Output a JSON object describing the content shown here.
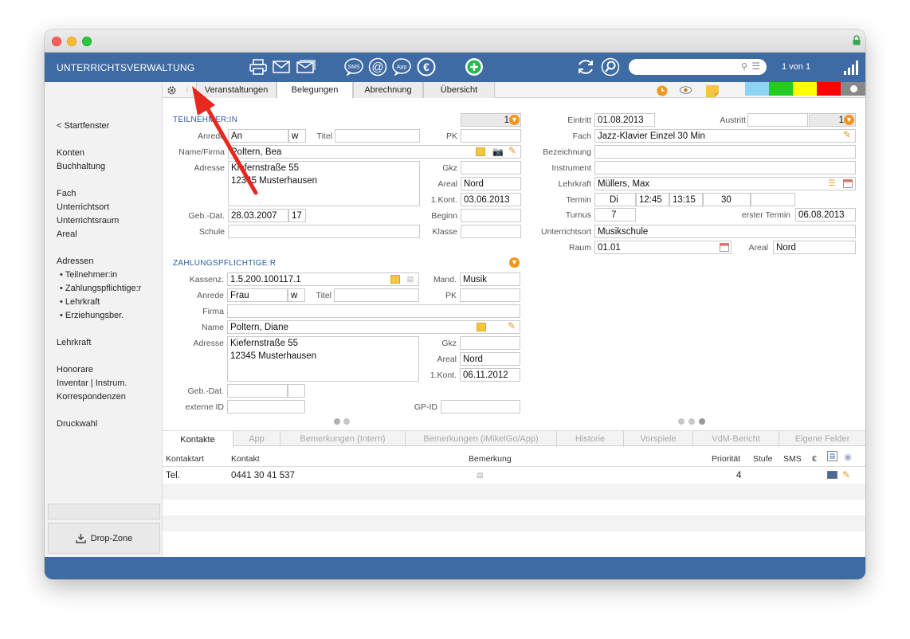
{
  "window": {
    "app_title": "UNTERRICHTSVERWALTUNG",
    "record_count": "1 von 1",
    "search_placeholder": ""
  },
  "toolbar_icons": [
    "printer-icon",
    "envelope-icon",
    "envelope-stack-icon",
    "sms-icon",
    "at-icon",
    "app-icon",
    "euro-icon",
    "add-icon",
    "refresh-icon",
    "search-icon"
  ],
  "sidebar": {
    "back": "< Startfenster",
    "items": [
      "Konten",
      "Buchhaltung",
      "Fach",
      "Unterrichtsort",
      "Unterrichtsraum",
      "Areal",
      "Adressen",
      "Lehrkraft",
      "Honorare",
      "Inventar | Instrum.",
      "Korrespondenzen",
      "Druckwahl"
    ],
    "sub_items": [
      "• Teilnehmer:in",
      "• Zahlungspflichtige:r",
      "• Lehrkraft",
      "• Erziehungsber."
    ],
    "dropzone": "Drop-Zone"
  },
  "tabs": [
    "Veranstaltungen",
    "Belegungen",
    "Abrechnung",
    "Übersicht"
  ],
  "active_tab": "Belegungen",
  "color_swatches": [
    "#8fd3f4",
    "#22cc22",
    "#ffff00",
    "#ff0000",
    "#888888"
  ],
  "teilnehmer": {
    "section": "TEILNEHMER:IN",
    "counter": "1",
    "labels": {
      "anrede": "Anrede",
      "titel": "Titel",
      "pk": "PK",
      "name": "Name/Firma",
      "adresse": "Adresse",
      "gkz": "Gkz",
      "areal": "Areal",
      "kont": "1.Kont.",
      "geb": "Geb.-Dat.",
      "beginn": "Beginn",
      "schule": "Schule",
      "klasse": "Klasse"
    },
    "anrede": "An",
    "gender": "w",
    "titel": "",
    "pk": "",
    "name": "Poltern, Bea",
    "adresse1": "Kiefernstraße 55",
    "adresse2": "12345 Musterhausen",
    "gkz": "",
    "areal": "Nord",
    "kont": "03.06.2013",
    "geb": "28.03.2007",
    "age": "17",
    "beginn": "",
    "schule": "",
    "klasse": ""
  },
  "belegung": {
    "labels": {
      "eintritt": "Eintritt",
      "austritt": "Austritt",
      "fach": "Fach",
      "bezeichnung": "Bezeichnung",
      "instrument": "Instrument",
      "lehrkraft": "Lehrkraft",
      "termin": "Termin",
      "turnus": "Turnus",
      "erster": "erster Termin",
      "ort": "Unterrichtsort",
      "raum": "Raum",
      "areal": "Areal"
    },
    "eintritt": "01.08.2013",
    "austritt": "",
    "counter": "1",
    "fach": "Jazz-Klavier Einzel 30 Min",
    "bezeichnung": "",
    "instrument": "",
    "lehrkraft": "Müllers, Max",
    "termin_tag": "Di",
    "termin_von": "12:45",
    "termin_bis": "13:15",
    "termin_dauer": "30",
    "turnus": "7",
    "erster_termin": "06.08.2013",
    "ort": "Musikschule",
    "raum": "01.01",
    "areal": "Nord"
  },
  "zahlungspflichtige": {
    "section": "ZAHLUNGSPFLICHTIGE:R",
    "labels": {
      "kassenz": "Kassenz.",
      "mand": "Mand.",
      "anrede": "Anrede",
      "titel": "Titel",
      "pk": "PK",
      "firma": "Firma",
      "name": "Name",
      "adresse": "Adresse",
      "gkz": "Gkz",
      "areal": "Areal",
      "kont": "1.Kont.",
      "geb": "Geb.-Dat.",
      "extid": "externe ID",
      "gpid": "GP-ID"
    },
    "kassenz": "1.5.200.100117.1",
    "mand": "Musik",
    "anrede": "Frau",
    "gender": "w",
    "titel": "",
    "pk": "",
    "firma": "",
    "name": "Poltern, Diane",
    "adresse1": "Kiefernstraße 55",
    "adresse2": "12345 Musterhausen",
    "gkz": "",
    "areal": "Nord",
    "kont": "06.11.2012",
    "geb": "",
    "extid": "",
    "gpid": ""
  },
  "bottom_tabs": [
    "Kontakte",
    "App",
    "Bemerkungen (Intern)",
    "Bemerkungen (iMikelGo/App)",
    "Historie",
    "Vorspiele",
    "VdM-Bericht",
    "Eigene Felder"
  ],
  "contacts": {
    "headers": {
      "art": "Kontaktart",
      "kontakt": "Kontakt",
      "bemerkung": "Bemerkung",
      "prioritaet": "Priorität",
      "stufe": "Stufe",
      "sms": "SMS",
      "euro": "€"
    },
    "rows": [
      {
        "art": "Tel.",
        "kontakt": "0441 30 41 537",
        "bemerkung": "",
        "prioritaet": "4",
        "stufe": "",
        "sms": ""
      }
    ]
  }
}
